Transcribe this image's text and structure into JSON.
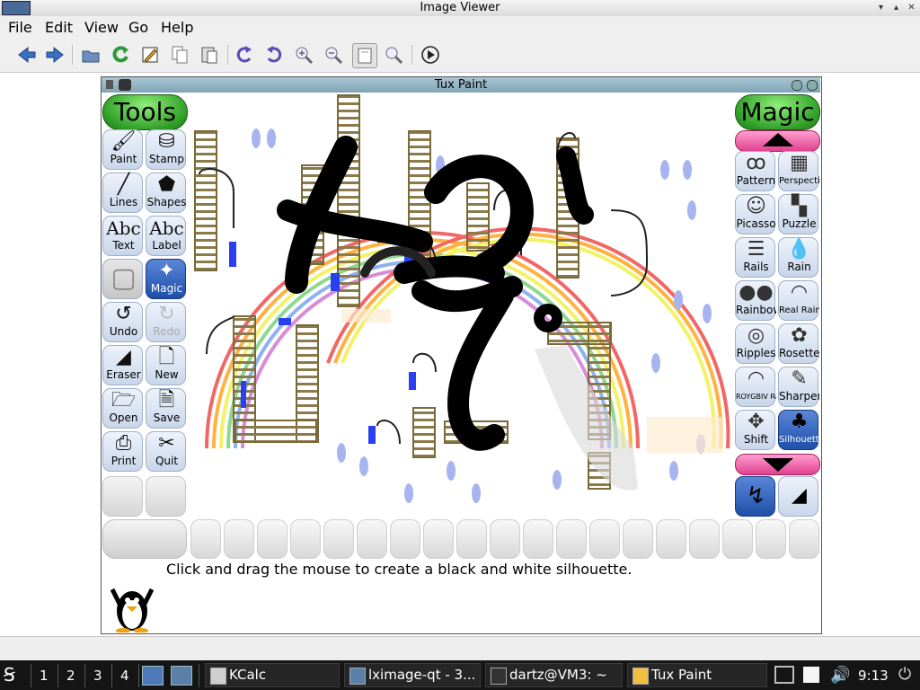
{
  "viewer": {
    "title": "Image Viewer",
    "menu": {
      "file": "File",
      "edit": "Edit",
      "view": "View",
      "go": "Go",
      "help": "Help"
    }
  },
  "tuxpaint": {
    "title": "Tux Paint",
    "tools_header": "Tools",
    "magic_header": "Magic",
    "tools": [
      {
        "label": "Paint",
        "icon": "brush-icon",
        "glyph": "🖌"
      },
      {
        "label": "Stamp",
        "icon": "stamp-icon",
        "glyph": "⛁"
      },
      {
        "label": "Lines",
        "icon": "lines-icon",
        "glyph": "╱"
      },
      {
        "label": "Shapes",
        "icon": "pentagon-icon",
        "glyph": "⬟"
      },
      {
        "label": "Text",
        "icon": "text-abc-icon",
        "glyph": "Abc"
      },
      {
        "label": "Label",
        "icon": "label-abc-icon",
        "glyph": "Abc"
      },
      {
        "label": "",
        "icon": "blank-tool-icon",
        "glyph": "▢"
      },
      {
        "label": "Magic",
        "icon": "magic-wand-icon",
        "glyph": "✦",
        "selected": true
      },
      {
        "label": "Undo",
        "icon": "undo-icon",
        "glyph": "↺"
      },
      {
        "label": "Redo",
        "icon": "redo-icon",
        "glyph": "↻",
        "disabled": true
      },
      {
        "label": "Eraser",
        "icon": "eraser-icon",
        "glyph": "◢"
      },
      {
        "label": "New",
        "icon": "new-page-icon",
        "glyph": "🗋"
      },
      {
        "label": "Open",
        "icon": "open-icon",
        "glyph": "🗁"
      },
      {
        "label": "Save",
        "icon": "save-icon",
        "glyph": "🗎"
      },
      {
        "label": "Print",
        "icon": "print-icon",
        "glyph": "⎙"
      },
      {
        "label": "Quit",
        "icon": "quit-icon",
        "glyph": "✂"
      }
    ],
    "magic": [
      {
        "label": "Pattern",
        "icon": "pattern-icon",
        "glyph": "ꝏ"
      },
      {
        "label": "Perspective",
        "icon": "perspective-icon",
        "glyph": "▦"
      },
      {
        "label": "Picasso",
        "icon": "picasso-icon",
        "glyph": "☺"
      },
      {
        "label": "Puzzle",
        "icon": "puzzle-icon",
        "glyph": "▚"
      },
      {
        "label": "Rails",
        "icon": "rails-icon",
        "glyph": "☰"
      },
      {
        "label": "Rain",
        "icon": "rain-icon",
        "glyph": "💧"
      },
      {
        "label": "Rainbow",
        "icon": "rainbow-icon",
        "glyph": "●●"
      },
      {
        "label": "Real Rainbow",
        "icon": "real-rainbow-icon",
        "glyph": "◠"
      },
      {
        "label": "Ripples",
        "icon": "ripples-icon",
        "glyph": "◎"
      },
      {
        "label": "Rosette",
        "icon": "rosette-icon",
        "glyph": "✿"
      },
      {
        "label": "ROYGBIV Rainbow",
        "icon": "roygbiv-rainbow-icon",
        "glyph": "◠"
      },
      {
        "label": "Sharpen",
        "icon": "sharpen-icon",
        "glyph": "✎"
      },
      {
        "label": "Shift",
        "icon": "shift-icon",
        "glyph": "✥"
      },
      {
        "label": "Silhouette",
        "icon": "silhouette-icon",
        "glyph": "♣",
        "selected": true
      }
    ],
    "instruction": "Click and drag the mouse to create a black and white silhouette."
  },
  "taskbar": {
    "desktops": [
      "1",
      "2",
      "3",
      "4"
    ],
    "tasks": [
      {
        "label": "KCalc",
        "icon": "calculator-icon"
      },
      {
        "label": "lximage-qt - 3...",
        "icon": "image-icon"
      },
      {
        "label": "dartz@VM3: ~",
        "icon": "terminal-icon"
      },
      {
        "label": "Tux Paint",
        "icon": "tux-paint-icon"
      }
    ],
    "clock": "9:13"
  }
}
